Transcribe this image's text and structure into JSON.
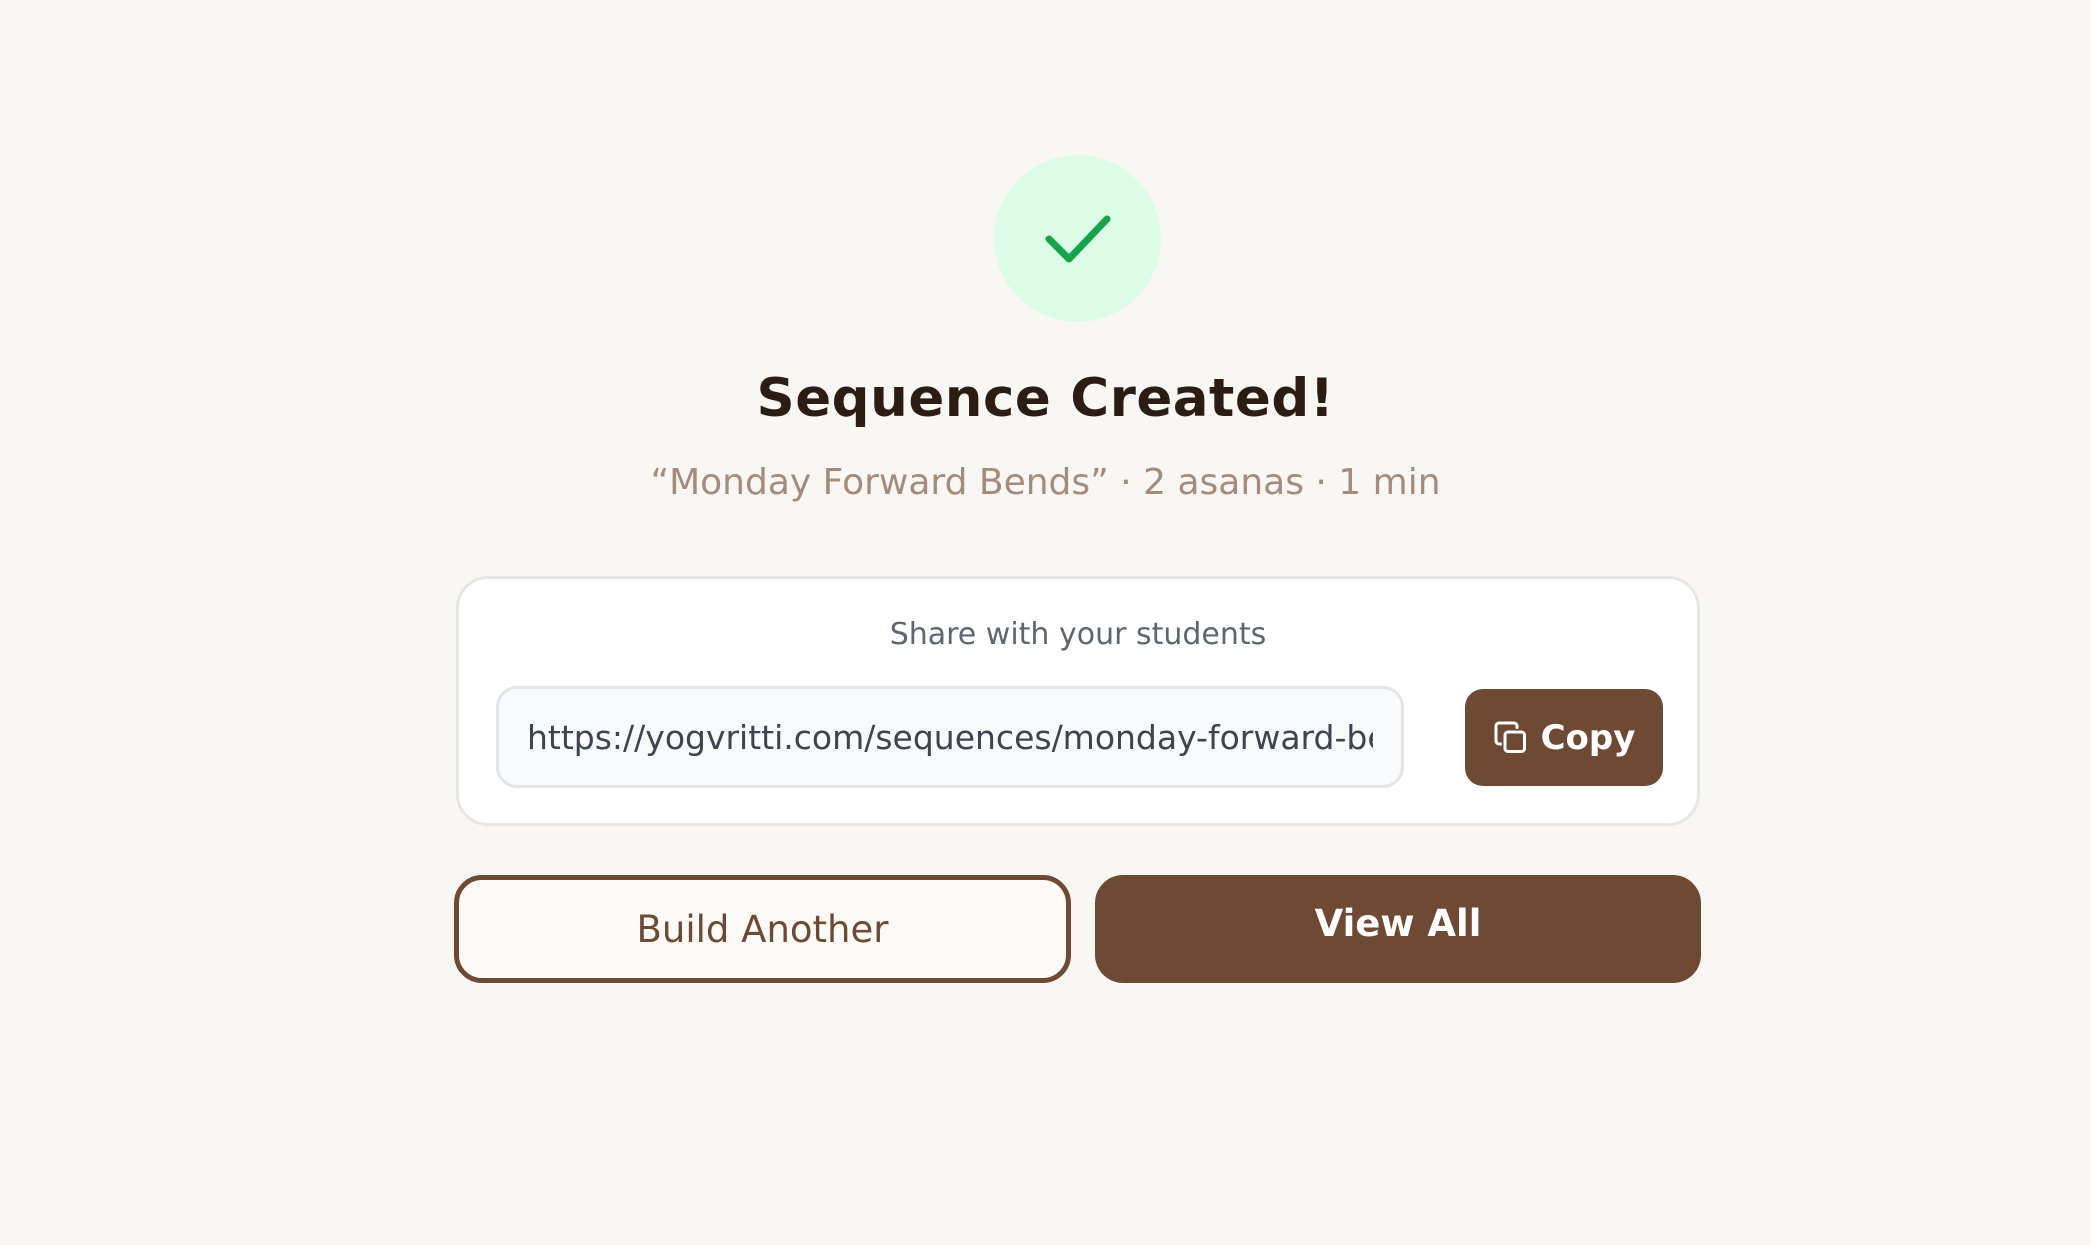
{
  "status": {
    "icon": "check-icon",
    "icon_color": "#16a34a",
    "circle_color": "#dcfce7"
  },
  "header": {
    "title": "Sequence Created!",
    "subtitle": "“Monday Forward Bends” · 2 asanas · 1 min"
  },
  "share": {
    "label": "Share with your students",
    "url": "https://yogvritti.com/sequences/monday-forward-bends",
    "copy_icon": "copy-icon",
    "copy_label": "Copy"
  },
  "actions": {
    "build_another_label": "Build Another",
    "view_all_label": "View All"
  },
  "colors": {
    "accent": "#6e4a34",
    "background": "#f9f7f4"
  }
}
